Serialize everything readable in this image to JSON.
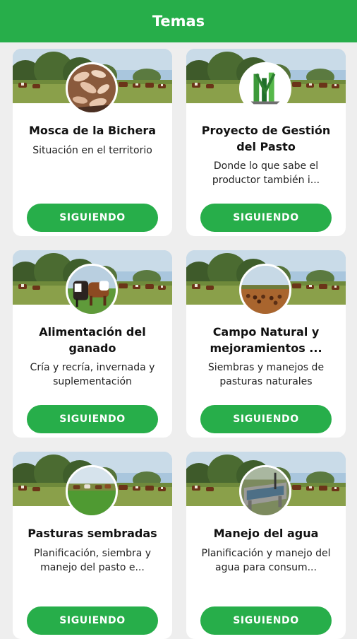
{
  "header": {
    "title": "Temas"
  },
  "colors": {
    "accent": "#27ae4a",
    "card": "#ffffff",
    "background": "#eeeeee"
  },
  "topics": [
    {
      "title": "Mosca de la Bichera",
      "description": "Situación en el territorio",
      "button_label": "SIGUIENDO",
      "icon": "larvae-photo"
    },
    {
      "title": "Proyecto de Gestión del Pasto",
      "description": "Donde lo que sabe el productor también i...",
      "button_label": "SIGUIENDO",
      "icon": "grass-project-logo"
    },
    {
      "title": "Alimentación del ganado",
      "description": "Cría y recría, invernada y suplementación",
      "button_label": "SIGUIENDO",
      "icon": "cattle-photo"
    },
    {
      "title": "Campo Natural y mejoramientos ...",
      "description": "Siembras y manejos de pasturas naturales",
      "button_label": "SIGUIENDO",
      "icon": "field-cattle-photo"
    },
    {
      "title": "Pasturas sembradas",
      "description": "Planificación, siembra y manejo del pasto e...",
      "button_label": "SIGUIENDO",
      "icon": "sown-pasture-photo"
    },
    {
      "title": "Manejo del agua",
      "description": "Planificación y manejo del agua para consum...",
      "button_label": "SIGUIENDO",
      "icon": "water-trough-photo"
    }
  ]
}
